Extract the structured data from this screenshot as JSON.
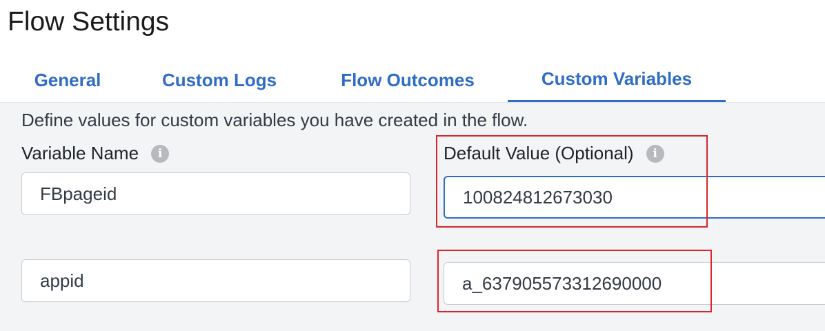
{
  "page": {
    "title": "Flow Settings"
  },
  "tabs": [
    {
      "label": "General",
      "active": false
    },
    {
      "label": "Custom Logs",
      "active": false
    },
    {
      "label": "Flow Outcomes",
      "active": false
    },
    {
      "label": "Custom Variables",
      "active": true
    }
  ],
  "custom_variables": {
    "description": "Define values for custom variables you have created in the flow.",
    "name_column_label": "Variable Name",
    "value_column_label": "Default Value (Optional)",
    "info_icon": "i",
    "rows": [
      {
        "name": "FBpageid",
        "value": "100824812673030"
      },
      {
        "name": "appid",
        "value": "a_637905573312690000"
      }
    ]
  },
  "colors": {
    "accent": "#2f6dc4",
    "highlight_box": "#d9262c",
    "content_bg": "#f3f4f6"
  }
}
